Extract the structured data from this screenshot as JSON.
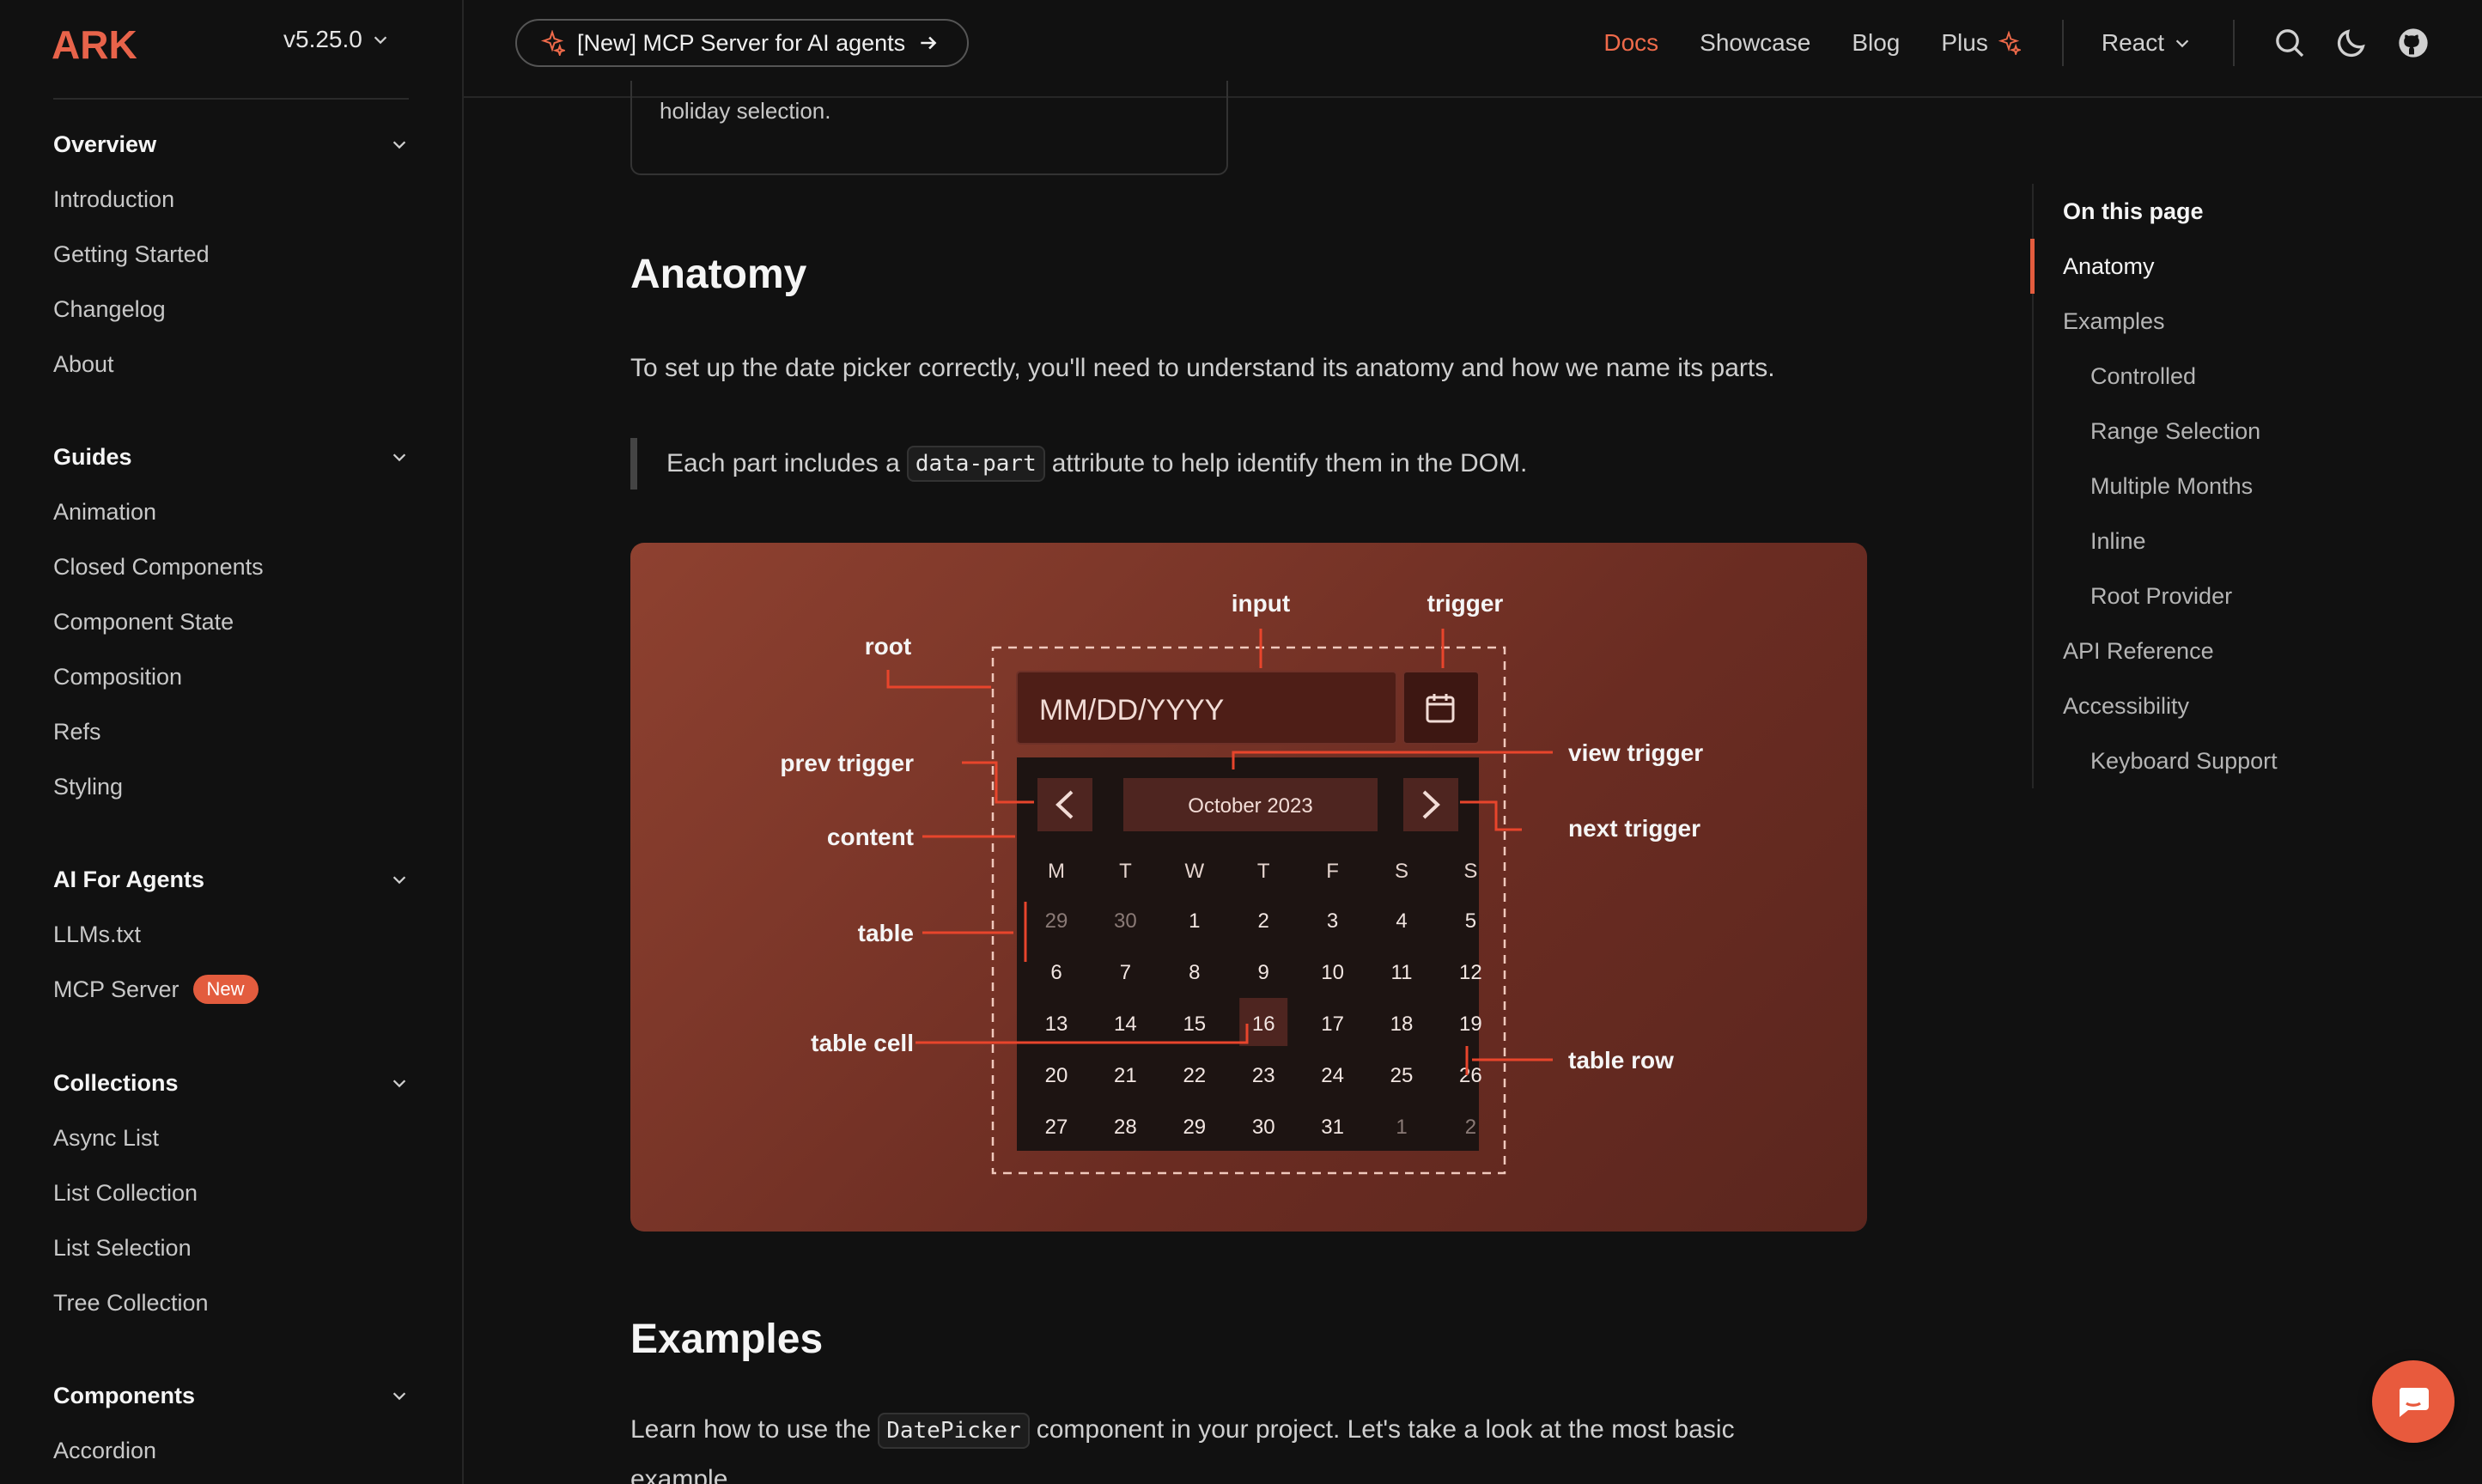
{
  "brand": {
    "logo_text": "ARK",
    "version": "v5.25.0",
    "accent": "#e35c3e"
  },
  "announcement": {
    "label": "[New] MCP Server for AI agents"
  },
  "topnav": {
    "docs": "Docs",
    "showcase": "Showcase",
    "blog": "Blog",
    "plus": "Plus",
    "framework": "React"
  },
  "sidebar": {
    "overview": {
      "title": "Overview",
      "items": [
        "Introduction",
        "Getting Started",
        "Changelog",
        "About"
      ]
    },
    "guides": {
      "title": "Guides",
      "items": [
        "Animation",
        "Closed Components",
        "Component State",
        "Composition",
        "Refs",
        "Styling"
      ]
    },
    "ai": {
      "title": "AI For Agents",
      "items": [
        "LLMs.txt",
        "MCP Server"
      ],
      "badge": "New"
    },
    "collections": {
      "title": "Collections",
      "items": [
        "Async List",
        "List Collection",
        "List Selection",
        "Tree Collection"
      ]
    },
    "components": {
      "title": "Components",
      "items": [
        "Accordion"
      ]
    }
  },
  "main": {
    "callout_text": "holiday selection.",
    "anatomy_title": "Anatomy",
    "anatomy_intro": "To set up the date picker correctly, you'll need to understand its anatomy and how we name its parts.",
    "quote_before": "Each part includes a",
    "quote_code": "data-part",
    "quote_after": "attribute to help identify them in the DOM.",
    "examples_title": "Examples",
    "examples_before": "Learn how to use the",
    "examples_code": "DatePicker",
    "examples_after": "component in your project. Let's take a look at the most basic",
    "examples_overflow": "example"
  },
  "diagram": {
    "labels": {
      "input": "input",
      "trigger": "trigger",
      "root": "root",
      "prev_trigger": "prev trigger",
      "view_trigger": "view trigger",
      "next_trigger": "next trigger",
      "content": "content",
      "table": "table",
      "table_cell": "table cell",
      "table_row": "table row"
    },
    "input_placeholder": "MM/DD/YYYY",
    "month_label": "October 2023",
    "weekdays": [
      "M",
      "T",
      "W",
      "T",
      "F",
      "S",
      "S"
    ],
    "weeks": [
      [
        "29",
        "30",
        "1",
        "2",
        "3",
        "4",
        "5"
      ],
      [
        "6",
        "7",
        "8",
        "9",
        "10",
        "11",
        "12"
      ],
      [
        "13",
        "14",
        "15",
        "16",
        "17",
        "18",
        "19"
      ],
      [
        "20",
        "21",
        "22",
        "23",
        "24",
        "25",
        "26"
      ],
      [
        "27",
        "28",
        "29",
        "30",
        "31",
        "1",
        "2"
      ]
    ],
    "outside_cells": [
      [
        0,
        0
      ],
      [
        0,
        1
      ],
      [
        4,
        5
      ],
      [
        4,
        6
      ]
    ],
    "highlighted_cell": [
      2,
      3
    ],
    "annotation_color": "#e8452c"
  },
  "toc": {
    "title": "On this page",
    "items": [
      {
        "label": "Anatomy",
        "level": 1,
        "active": true
      },
      {
        "label": "Examples",
        "level": 1
      },
      {
        "label": "Controlled",
        "level": 2
      },
      {
        "label": "Range Selection",
        "level": 2
      },
      {
        "label": "Multiple Months",
        "level": 2
      },
      {
        "label": "Inline",
        "level": 2
      },
      {
        "label": "Root Provider",
        "level": 2
      },
      {
        "label": "API Reference",
        "level": 1
      },
      {
        "label": "Accessibility",
        "level": 1
      },
      {
        "label": "Keyboard Support",
        "level": 2
      }
    ]
  }
}
